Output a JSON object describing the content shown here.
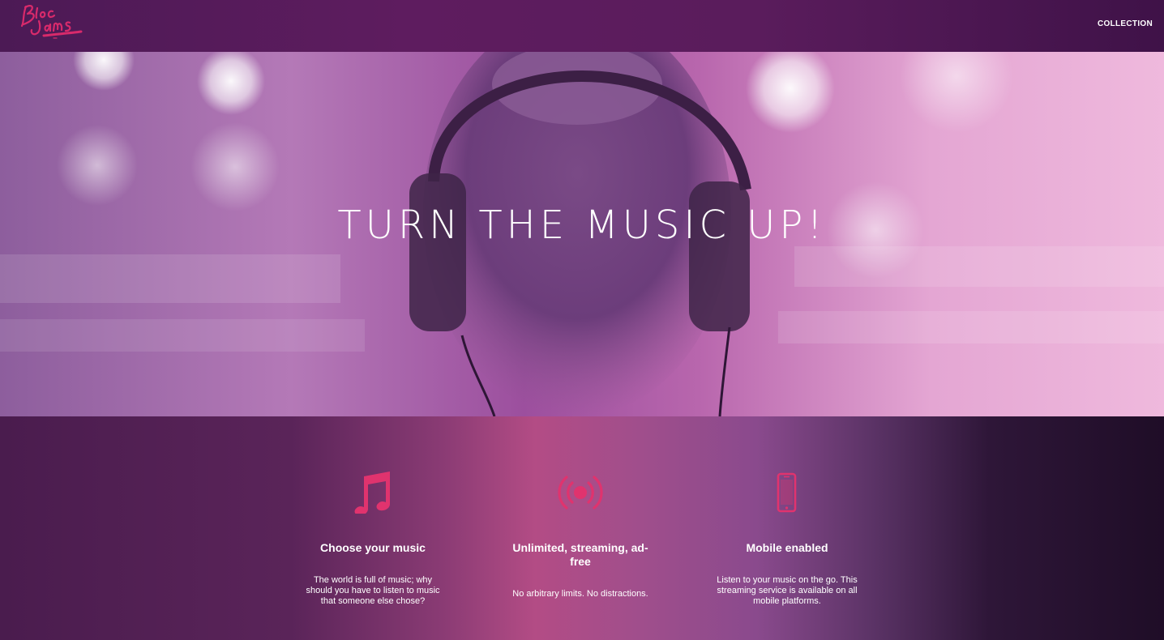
{
  "navbar": {
    "logo_text": "Bloc Jams",
    "link_collection": "COLLECTION"
  },
  "hero": {
    "title": "TURN THE MUSIC UP!"
  },
  "features": [
    {
      "icon": "music-note-icon",
      "title": "Choose your music",
      "text": "The world is full of music; why should you have to listen to music that someone else chose?"
    },
    {
      "icon": "broadcast-icon",
      "title": "Unlimited, streaming, ad-free",
      "text": "No arbitrary limits. No distractions."
    },
    {
      "icon": "mobile-phone-icon",
      "title": "Mobile enabled",
      "text": "Listen to your music on the go. This streaming service is available on all mobile platforms."
    }
  ],
  "colors": {
    "accent_pink": "#e0336e",
    "navbar_purple": "#5e1c5f"
  }
}
